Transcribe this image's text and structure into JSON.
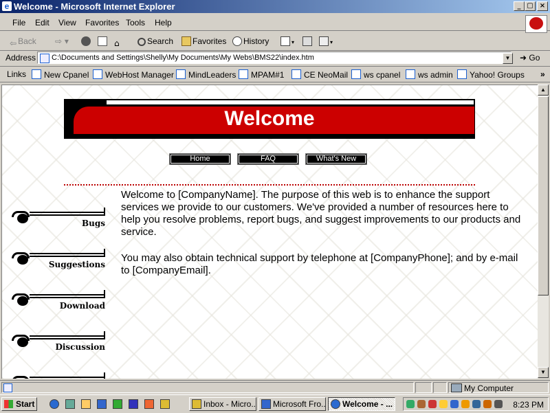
{
  "window": {
    "title": "Welcome - Microsoft Internet Explorer",
    "minimize": "_",
    "maximize": "▢",
    "close": "×"
  },
  "menu": [
    "File",
    "Edit",
    "View",
    "Favorites",
    "Tools",
    "Help"
  ],
  "toolbar": {
    "back": "Back",
    "search": "Search",
    "favorites": "Favorites",
    "history": "History"
  },
  "address": {
    "label": "Address",
    "value": "C:\\Documents and Settings\\Shelly\\My Documents\\My Webs\\BMS22\\index.htm",
    "go": "Go"
  },
  "links": {
    "label": "Links",
    "items": [
      "New Cpanel",
      "WebHost Manager",
      "MindLeaders",
      "MPAM#1",
      "CE NeoMail",
      "ws cpanel",
      "ws admin",
      "Yahoo! Groups"
    ],
    "more": "»"
  },
  "page": {
    "banner_title": "Welcome",
    "nav": [
      "Home",
      "FAQ",
      "What's New"
    ],
    "sidebar": [
      "Bugs",
      "Suggestions",
      "Download",
      "Discussion"
    ],
    "paragraphs": [
      "Welcome to [CompanyName]. The purpose of this web is to enhance the support services we provide to our customers. We've provided a number of resources here to help you resolve problems, report bugs, and suggest improvements to our products and service.",
      "You may also obtain technical support by telephone at [CompanyPhone]; and by e-mail to [CompanyEmail]."
    ]
  },
  "status": {
    "zone": "My Computer"
  },
  "taskbar": {
    "start": "Start",
    "tasks": [
      {
        "label": "Inbox - Micro...",
        "active": false
      },
      {
        "label": "Microsoft Fro...",
        "active": false
      },
      {
        "label": "Welcome - ...",
        "active": true
      }
    ],
    "clock": "8:23 PM"
  },
  "colors": {
    "banner_red": "#cc0000",
    "titlebar": "#0a246a",
    "dots": "#bb0000"
  }
}
